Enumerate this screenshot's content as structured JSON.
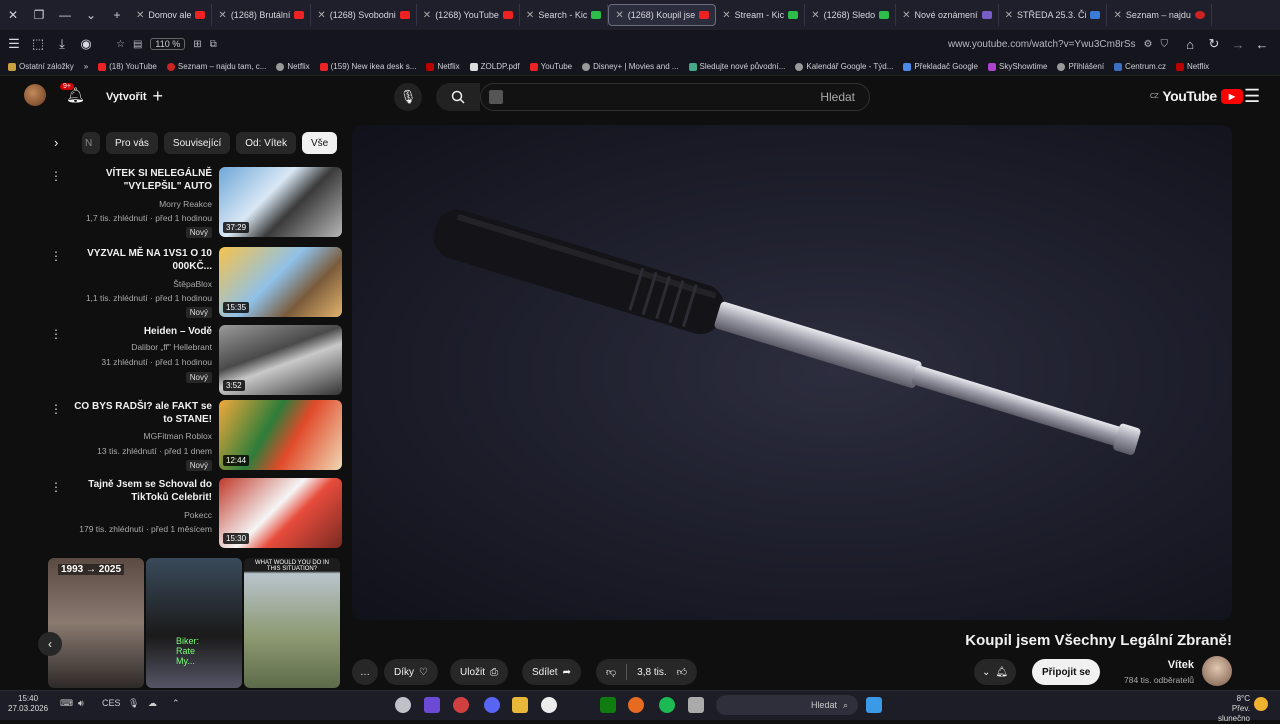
{
  "browser": {
    "tabs": [
      {
        "label": "Seznam – najdu"
      },
      {
        "label": "STŘEDA 25.3. Či"
      },
      {
        "label": "Nové oznámení"
      },
      {
        "label": "(1268) Sledo"
      },
      {
        "label": "Stream - Kic"
      },
      {
        "label": "(1268) Koupil jse"
      },
      {
        "label": "Search - Kic"
      },
      {
        "label": "(1268) YouTube"
      },
      {
        "label": "(1268) Svobodni"
      },
      {
        "label": "(1268) Brutální"
      },
      {
        "label": "Domov ale"
      }
    ],
    "active_tab_index": 5,
    "url": "www.youtube.com/watch?v=Ywu3Cm8rSs",
    "zoom": "110 %",
    "bookmarks": [
      "Netflix",
      "Centrum.cz",
      "Přihlášení",
      "SkyShowtime",
      "Překladač Google",
      "Kalendář Google - Týd...",
      "Sledujte nové původní...",
      "Disney+ | Movies and ...",
      "YouTube",
      "ZOLDP.pdf",
      "Netflix",
      "(159) New ikea desk s...",
      "Netflix",
      "Seznam – najdu tam, c...",
      "(18) YouTube",
      "Ostatní záložky"
    ]
  },
  "youtube": {
    "logo_text": "YouTube",
    "region": "CZ",
    "search_placeholder": "Hledat",
    "create_label": "Vytvořit",
    "notif_count": "9+",
    "chips": [
      "Vše",
      "Od: Vítek",
      "Související",
      "Pro vás",
      "N"
    ],
    "recommendations": [
      {
        "title": "VÍTEK SI NELEGÁLNĚ \"VYLEPŠIL\" AUTO",
        "channel": "Morry Reakce",
        "stats": "1,7 tis. zhlédnutí · před 1 hodinou",
        "badge": "Nový",
        "duration": "37:29"
      },
      {
        "title": "VYZVAL MĚ NA 1VS1 O 10 000KČ...",
        "channel": "ŠtěpaBlox",
        "stats": "1,1 tis. zhlédnutí · před 1 hodinou",
        "badge": "Nový",
        "duration": "15:35"
      },
      {
        "title": "Heiden – Vodě",
        "channel": "Dalibor „ff\" Hellebrant",
        "stats": "31 zhlédnutí · před 1 hodinou",
        "badge": "Nový",
        "duration": "3:52"
      },
      {
        "title": "CO BYS RADŠI? ale FAKT se to STANE!",
        "channel": "MGFitman Roblox",
        "stats": "13 tis. zhlédnutí · před 1 dnem",
        "badge": "Nový",
        "duration": "12:44"
      },
      {
        "title": "Tajně Jsem se Schoval do TikToků Celebrit!",
        "channel": "Pokecc",
        "stats": "179 tis. zhlédnutí · před 1 měsícem",
        "badge": "",
        "duration": "15:30"
      }
    ],
    "shorts": [
      {
        "label": "1993 → 2025"
      },
      {
        "label": "Biker: Rate My..."
      },
      {
        "label": "WHAT WOULD YOU DO IN THIS SITUATION?"
      }
    ],
    "video": {
      "title": "Koupil jsem Všechny Legální Zbraně!",
      "channel": "Vítek",
      "subscribers": "784 tis. odběratelů",
      "join_label": "Připojit se",
      "likes": "3,8 tis.",
      "share_label": "Sdílet",
      "save_label": "Uložit",
      "thanks_label": "Díky"
    }
  },
  "taskbar": {
    "search_placeholder": "Hledat",
    "time": "15:40",
    "date": "27.03.2026",
    "lang": "CES",
    "weather_temp": "8°C",
    "weather_desc": "Přev. slunečno"
  },
  "colors": {
    "accent": "#ff0000",
    "background": "#0f0f0f",
    "chip_bg": "#272727"
  }
}
